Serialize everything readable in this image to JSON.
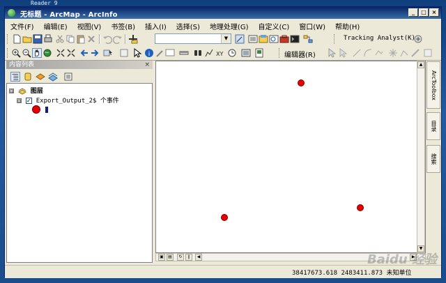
{
  "desktop": {
    "label": "Reader 9"
  },
  "window": {
    "title": "无标题 - ArcMap - ArcInfo",
    "btn_min": "_",
    "btn_max": "□",
    "btn_close": "×"
  },
  "menu": {
    "items": [
      "文件(F)",
      "编辑(E)",
      "视图(V)",
      "书签(B)",
      "插入(I)",
      "选择(S)",
      "地理处理(G)",
      "自定义(C)",
      "窗口(W)",
      "帮助(H)"
    ]
  },
  "toolbar": {
    "tracking_label": "Tracking Analyst(K)",
    "editor_label": "编辑器(R)",
    "scale_value": ""
  },
  "toc": {
    "title": "内容列表",
    "close": "×",
    "root_expander": "⊟",
    "root_label": "图层",
    "layer_expander": "⊟",
    "layer_check": "✓",
    "layer_label": "Export_Output_2$ 个事件"
  },
  "right_tabs": [
    "ArcToolbox",
    "目录",
    "搜索"
  ],
  "status": {
    "coordinates": "38417673.618  2483411.873 未知单位"
  },
  "watermark": "Baidu 经验",
  "colors": {
    "point": "#e60000",
    "title_bar": "#0a246a",
    "chrome": "#ece9d8"
  }
}
